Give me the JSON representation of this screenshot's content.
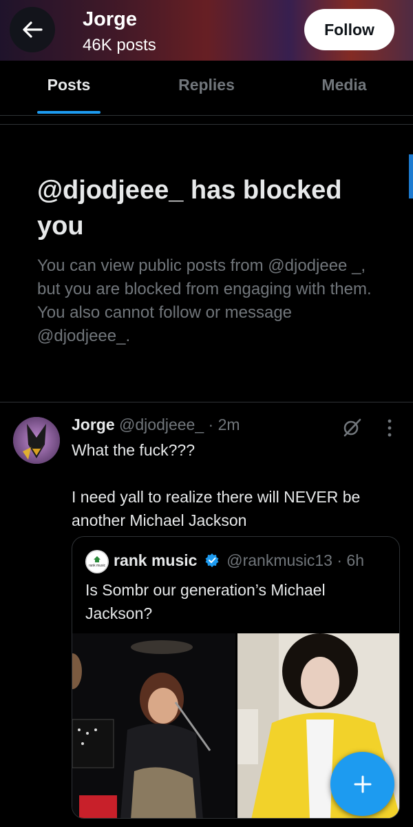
{
  "header": {
    "title": "Jorge",
    "subtitle": "46K posts",
    "follow_label": "Follow"
  },
  "tabs": [
    {
      "label": "Posts",
      "active": true
    },
    {
      "label": "Replies",
      "active": false
    },
    {
      "label": "Media",
      "active": false
    }
  ],
  "blocked": {
    "title": "@djodjeee_ has blocked you",
    "body": "You can view public posts from @djodjeee _, but you are blocked from engaging with them. You also cannot follow or message @djodjeee_."
  },
  "post": {
    "name": "Jorge",
    "meta": "@djodjeee_ · 2m",
    "line1": "What the fuck???",
    "line2": "I need yall to realize there will NEVER be another Michael Jackson",
    "quote": {
      "avatar_text": "rank music",
      "name": "rank music",
      "meta": "@rankmusic13 · 6h",
      "text": "Is Sombr our generation’s Michael Jackson?"
    }
  },
  "icons": {
    "back": "arrow-left-icon",
    "grok": "grok-icon",
    "more": "more-vertical-icon",
    "verified": "verified-badge-icon",
    "compose": "plus-icon"
  },
  "colors": {
    "accent": "#1d9bf0",
    "background": "#000000",
    "text": "#e7e9ea",
    "muted": "#71767b"
  }
}
